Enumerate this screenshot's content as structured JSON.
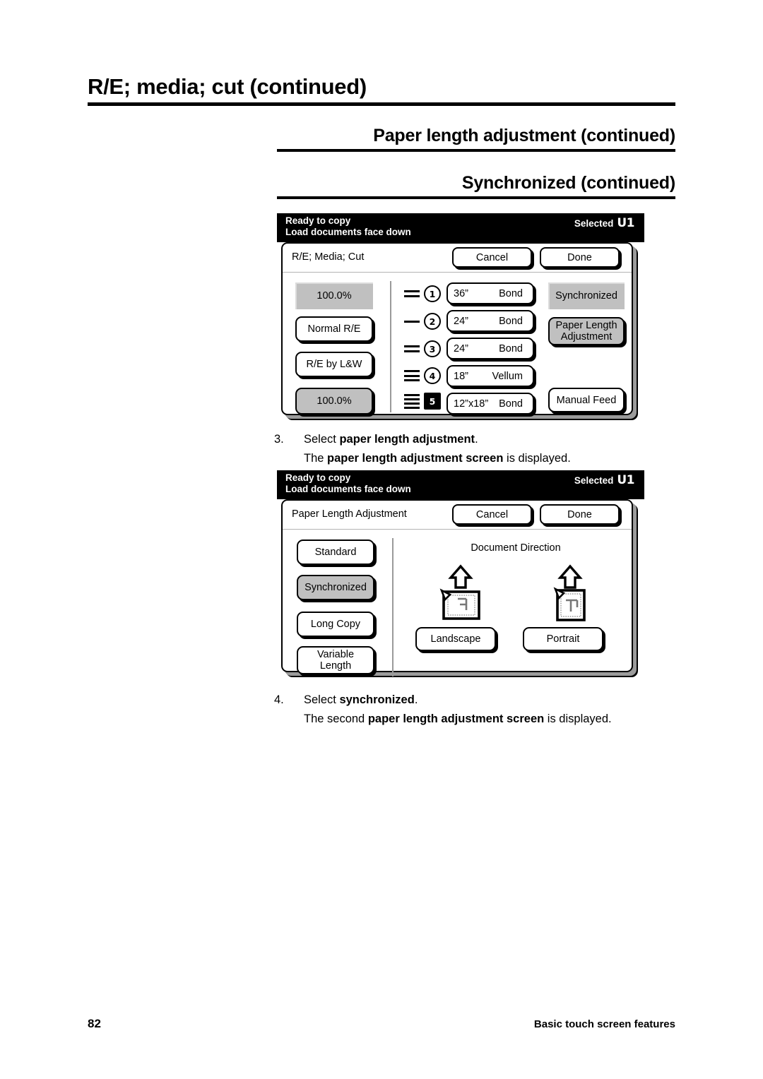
{
  "page": {
    "heading_main": "R/E; media; cut (continued)",
    "heading_sub1": "Paper length adjustment (continued)",
    "heading_sub2": "Synchronized (continued)",
    "footer_page_number": "82",
    "footer_section": "Basic touch screen features"
  },
  "screen1": {
    "status": {
      "line1": "Ready to copy",
      "line2": "Load documents face down",
      "selected_label": "Selected",
      "selected_value": "U1"
    },
    "titlebar": {
      "title": "R/E; Media; Cut",
      "cancel": "Cancel",
      "done": "Done"
    },
    "left_column": [
      {
        "label": "100.0%",
        "style": "display-gray"
      },
      {
        "label": "Normal R/E",
        "style": "button-white"
      },
      {
        "label": "R/E by L&W",
        "style": "button-white"
      },
      {
        "label": "100.0%",
        "style": "button-gray"
      }
    ],
    "media_rows": [
      {
        "bars": 2,
        "number": "1",
        "badge": "circle",
        "size": "36”",
        "type": "Bond"
      },
      {
        "bars": 1,
        "number": "2",
        "badge": "circle",
        "size": "24”",
        "type": "Bond"
      },
      {
        "bars": 2,
        "number": "3",
        "badge": "circle",
        "size": "24”",
        "type": "Bond"
      },
      {
        "bars": 3,
        "number": "4",
        "badge": "circle",
        "size": "18”",
        "type": "Vellum"
      },
      {
        "bars": 4,
        "number": "5",
        "badge": "box",
        "size": "12”x18”",
        "type": "Bond"
      }
    ],
    "right_column": [
      {
        "label": "Synchronized",
        "style": "display-gray"
      },
      {
        "label": "Paper Length\nAdjustment",
        "line1": "Paper Length",
        "line2": "Adjustment",
        "style": "button-gray"
      },
      {
        "label": "Manual Feed",
        "style": "button-white"
      }
    ]
  },
  "step3": {
    "number": "3.",
    "line1_plain_a": "Select ",
    "line1_bold": "paper length adjustment",
    "line1_plain_b": ".",
    "line2_plain_a": "The ",
    "line2_bold": "paper length adjustment screen",
    "line2_plain_b": " is displayed."
  },
  "screen2": {
    "status": {
      "line1": "Ready to copy",
      "line2": "Load documents face down",
      "selected_label": "Selected",
      "selected_value": "U1"
    },
    "titlebar": {
      "title": "Paper Length Adjustment",
      "cancel": "Cancel",
      "done": "Done"
    },
    "left_column": [
      {
        "label": "Standard",
        "style": "button-white"
      },
      {
        "label": "Synchronized",
        "style": "button-gray"
      },
      {
        "label": "Long Copy",
        "style": "button-white"
      },
      {
        "line1": "Variable",
        "line2": "Length",
        "style": "button-white"
      }
    ],
    "direction": {
      "heading": "Document Direction",
      "landscape_button": "Landscape",
      "portrait_button": "Portrait",
      "landscape_icon": "landscape-document-icon",
      "portrait_icon": "portrait-document-icon",
      "arrow_icon": "up-arrow-icon"
    }
  },
  "step4": {
    "number": "4.",
    "line1_plain_a": "Select ",
    "line1_bold": "synchronized",
    "line1_plain_b": ".",
    "line2_plain_a": "The second ",
    "line2_bold": "paper length adjustment screen",
    "line2_plain_b": " is displayed."
  },
  "colors": {
    "panel_gray": "#c0c0c0",
    "status_bar": "#000000",
    "shadow": "#000000",
    "divider": "#9a9a9a"
  }
}
